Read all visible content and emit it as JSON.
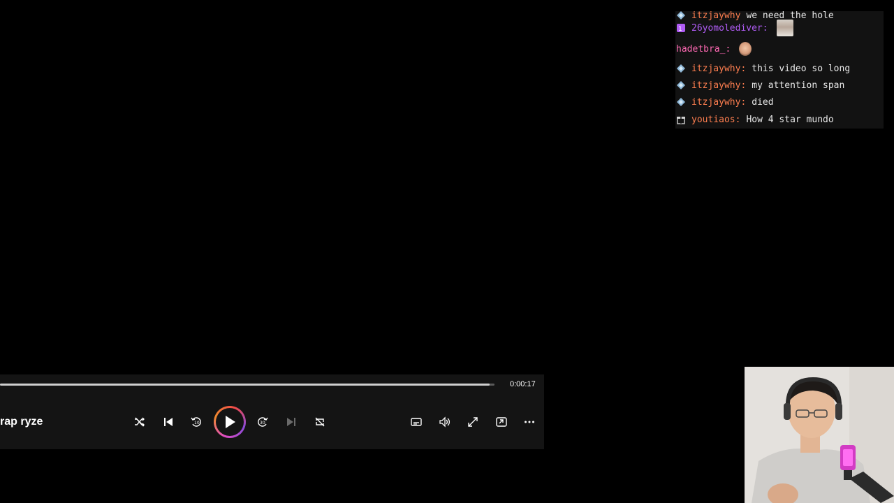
{
  "chat": {
    "messages": [
      {
        "user": "itzjaywhy",
        "color": "#ff7f50",
        "badge": "diamond-badge",
        "text": "we need the hole",
        "emote": ""
      },
      {
        "user": "26yomolediver",
        "color": "#b05cf5",
        "badge": "sub-badge",
        "text": "",
        "emote": "face-emote"
      },
      {
        "user": "hadetbra_",
        "color": "#ff69b4",
        "badge": "",
        "text": "",
        "emote": "head-emote"
      },
      {
        "user": "itzjaywhy",
        "color": "#ff7f50",
        "badge": "diamond-badge",
        "text": "this video so long",
        "emote": ""
      },
      {
        "user": "itzjaywhy",
        "color": "#ff7f50",
        "badge": "diamond-badge",
        "text": "my attention span",
        "emote": ""
      },
      {
        "user": "itzjaywhy",
        "color": "#ff7f50",
        "badge": "diamond-badge",
        "text": "died",
        "emote": ""
      },
      {
        "user": "youtiaos",
        "color": "#ff7f50",
        "badge": "gift-badge",
        "text": "How 4 star mundo",
        "emote": ""
      }
    ],
    "colon": ":"
  },
  "player": {
    "time": "0:00:17",
    "progress": 0.99,
    "title": "rap ryze",
    "accent_colors": [
      "#e14cc4",
      "#f08a2d",
      "#8a4bd8"
    ],
    "controls": [
      "shuffle-icon",
      "previous-icon",
      "rewind-10-icon",
      "play-icon",
      "forward-30-icon",
      "next-icon",
      "repeat-off-icon",
      "captions-icon",
      "volume-icon",
      "fullscreen-icon",
      "miniplayer-icon",
      "more-icon"
    ]
  }
}
